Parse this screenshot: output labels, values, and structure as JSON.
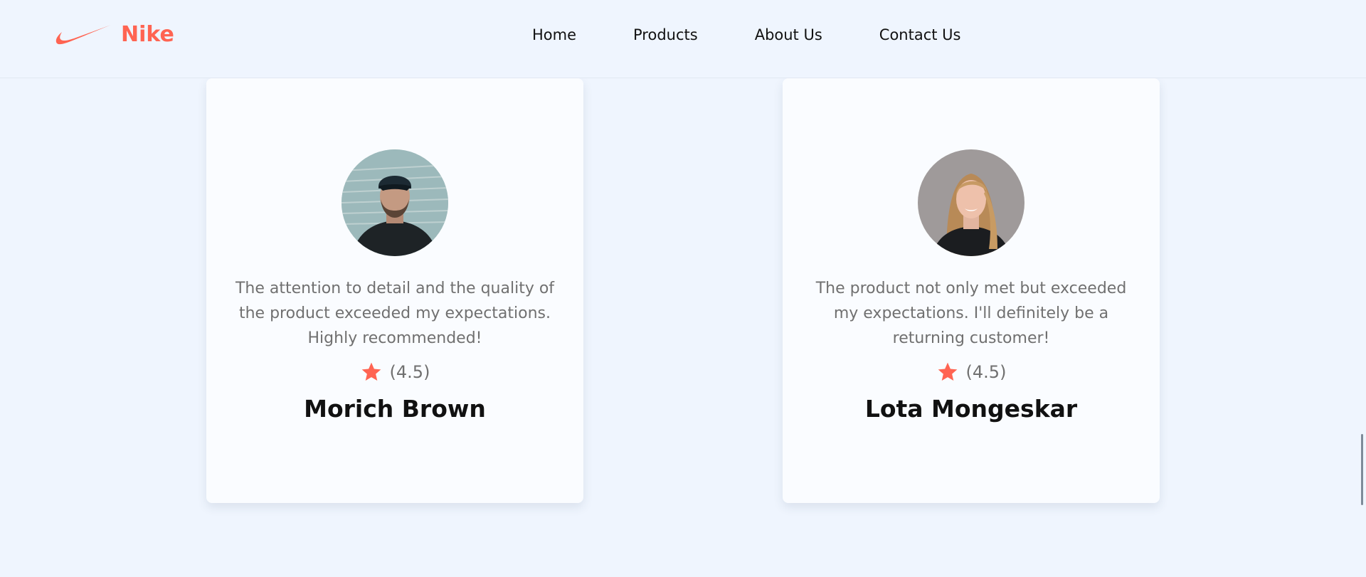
{
  "header": {
    "brand": "Nike",
    "nav": [
      {
        "label": "Home"
      },
      {
        "label": "Products"
      },
      {
        "label": "About Us"
      },
      {
        "label": "Contact Us"
      }
    ]
  },
  "reviews": [
    {
      "quote": "The attention to detail and the quality of the product exceeded my expectations. Highly recommended!",
      "rating": "(4.5)",
      "name": "Morich Brown",
      "avatar": "man-in-black-cap-photo"
    },
    {
      "quote": "The product not only met but exceeded my expectations. I'll definitely be a returning customer!",
      "rating": "(4.5)",
      "name": "Lota Mongeskar",
      "avatar": "smiling-blonde-woman-photo"
    }
  ],
  "colors": {
    "accent": "#ff6452",
    "background": "#eff5fe",
    "card": "#fafcff",
    "text_muted": "#707070",
    "text_dark": "#111111"
  }
}
